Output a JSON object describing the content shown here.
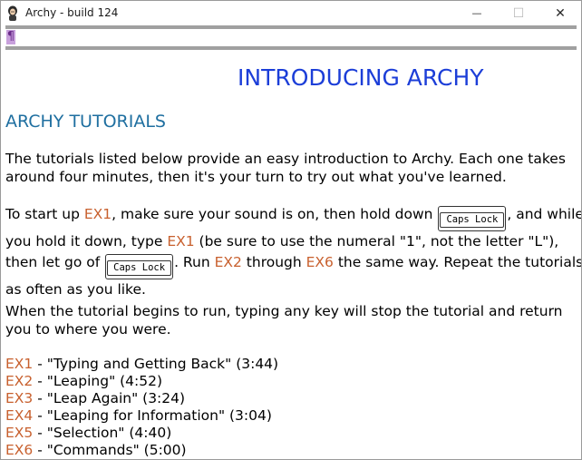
{
  "window": {
    "title": "Archy - build 124",
    "icon": "archy-app-icon"
  },
  "titlebar_buttons": {
    "minimize": "—",
    "maximize": "☐",
    "close": "✕"
  },
  "cursor_mark": "¶",
  "document": {
    "title": "INTRODUCING ARCHY",
    "section": "ARCHY TUTORIALS",
    "p1": "The tutorials listed below provide an easy introduction to Archy. Each one takes around four minutes, then it's your turn to try out what you've learned.",
    "p2": {
      "t1": "To start up ",
      "ex1": "EX1",
      "t2": ", make sure your sound is on, then hold down ",
      "key1": "Caps Lock",
      "t3": ", and while you hold it down, type ",
      "ex2": "EX1",
      "t4": " (be sure to use the numeral \"1\", not the letter \"L\"), then let go of ",
      "key2": "Caps Lock",
      "t5": ". Run ",
      "ex3": "EX2",
      "t6": " through ",
      "ex4": "EX6",
      "t7": " the same way. Repeat the tutorials as often as you like."
    },
    "p3": "When the tutorial begins to run, typing any key will stop the tutorial and return you to where you were.",
    "tutorials": [
      {
        "code": "EX1",
        "desc": " - \"Typing and Getting Back\" (3:44)"
      },
      {
        "code": "EX2",
        "desc": " - \"Leaping\" (4:52)"
      },
      {
        "code": "EX3",
        "desc": " - \"Leap Again\" (3:24)"
      },
      {
        "code": "EX4",
        "desc": " - \"Leaping for Information\" (3:04)"
      },
      {
        "code": "EX5",
        "desc": " - \"Selection\" (4:40)"
      },
      {
        "code": "EX6",
        "desc": " - \"Commands\" (5:00)"
      }
    ]
  },
  "colors": {
    "title": "#1c3ed8",
    "section": "#1f6fa0",
    "command": "#c8602e",
    "cursor": "#c8a0dc"
  }
}
